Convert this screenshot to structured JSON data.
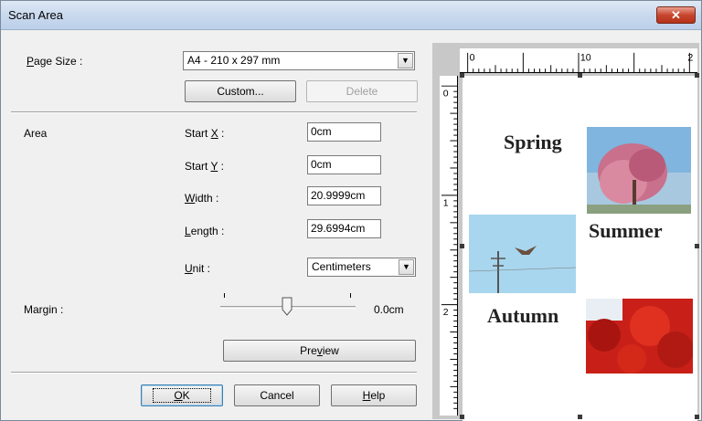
{
  "window": {
    "title": "Scan Area",
    "close_label": "✕"
  },
  "page_size": {
    "label_pre": "",
    "label_u": "P",
    "label_post": "age Size :",
    "selected": "A4 - 210 x 297 mm"
  },
  "buttons": {
    "custom": "Custom...",
    "delete": "Delete",
    "preview_pre": "Pre",
    "preview_u": "v",
    "preview_post": "iew",
    "ok_u": "O",
    "ok_post": "K",
    "cancel": "Cancel",
    "help_u": "H",
    "help_post": "elp"
  },
  "area": {
    "label": "Area",
    "start_x": {
      "label_pre": "Start ",
      "label_u": "X",
      "label_post": " :",
      "value": "0cm"
    },
    "start_y": {
      "label_pre": "Start ",
      "label_u": "Y",
      "label_post": " :",
      "value": "0cm"
    },
    "width": {
      "label_u": "W",
      "label_post": "idth :",
      "value": "20.9999cm"
    },
    "length": {
      "label_u": "L",
      "label_post": "ength :",
      "value": "29.6994cm"
    },
    "unit": {
      "label_u": "U",
      "label_post": "nit :",
      "selected": "Centimeters"
    }
  },
  "margin": {
    "label_pre": "Mar",
    "label_u": "g",
    "label_post": "in :",
    "value": "0.0cm",
    "slider_fraction": 0.5
  },
  "preview": {
    "ruler_top_labels": [
      "0",
      "10",
      "2"
    ],
    "ruler_left_labels": [
      "0",
      "1",
      "2"
    ],
    "seasons": {
      "spring": "Spring",
      "summer": "Summer",
      "autumn": "Autumn"
    }
  },
  "colors": {
    "accent": "#3c7fb1",
    "close_red": "#c7462e",
    "title_bg": "#c9d9ee"
  }
}
